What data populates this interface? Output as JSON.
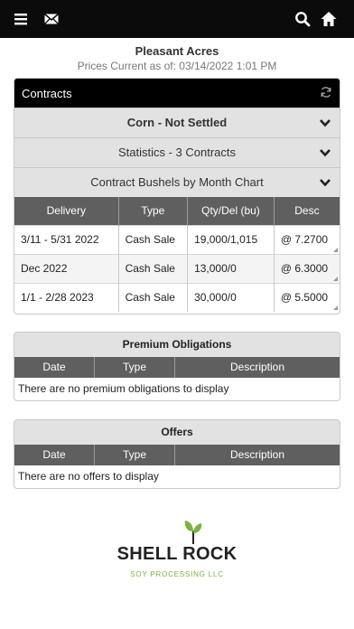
{
  "topbar": {
    "menu_icon": "hamburger-menu-icon",
    "mail_icon": "envelope-icon",
    "search_icon": "search-icon",
    "home_icon": "home-icon"
  },
  "header": {
    "farm_name": "Pleasant Acres",
    "prices_current": "Prices Current as of: 03/14/2022 1:01 PM"
  },
  "contracts": {
    "title": "Contracts",
    "commodity_section": "Corn - Not Settled",
    "statistics_section": "Statistics - 3 Contracts",
    "chart_section": "Contract Bushels by Month Chart",
    "columns": [
      "Delivery",
      "Type",
      "Qty/Del (bu)",
      "Desc"
    ],
    "rows": [
      {
        "delivery": "3/11 - 5/31 2022",
        "type": "Cash Sale",
        "qty": "19,000/1,015",
        "desc": "@ 7.2700"
      },
      {
        "delivery": "Dec 2022",
        "type": "Cash Sale",
        "qty": "13,000/0",
        "desc": "@ 6.3000"
      },
      {
        "delivery": "1/1 - 2/28 2023",
        "type": "Cash Sale",
        "qty": "30,000/0",
        "desc": "@ 5.5000"
      }
    ]
  },
  "premium": {
    "title": "Premium Obligations",
    "columns": [
      "Date",
      "Type",
      "Description"
    ],
    "empty": "There are no premium obligations to display"
  },
  "offers": {
    "title": "Offers",
    "columns": [
      "Date",
      "Type",
      "Description"
    ],
    "empty": "There are no offers to display"
  },
  "logo": {
    "name": "SHELL ROCK",
    "subtitle": "SOY PROCESSING LLC"
  },
  "colors": {
    "topbar": "#0b0b0b",
    "table_header": "#5f5f5f",
    "accordion": "#e2e2e2",
    "brand_green": "#7ab342"
  }
}
